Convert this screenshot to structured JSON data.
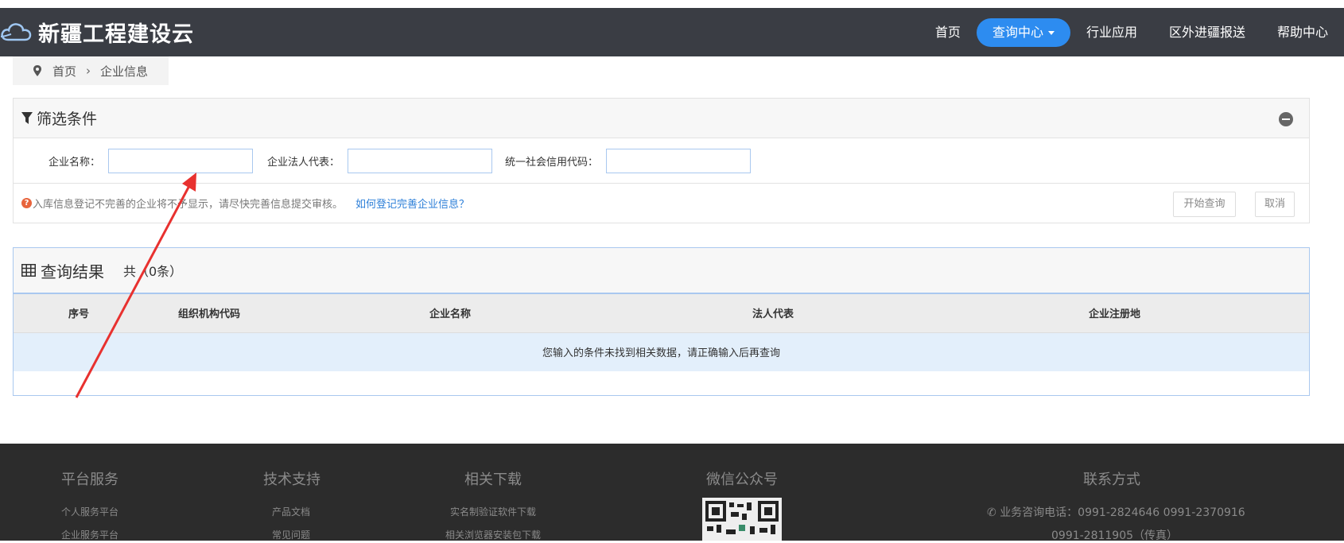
{
  "app": {
    "logo_text": "新疆工程建设云"
  },
  "nav": {
    "items": [
      {
        "label": "首页"
      },
      {
        "label": "查询中心",
        "active": true
      },
      {
        "label": "行业应用"
      },
      {
        "label": "区外进疆报送"
      },
      {
        "label": "帮助中心"
      }
    ]
  },
  "breadcrumb": {
    "home": "首页",
    "sep": "›",
    "current": "企业信息"
  },
  "filter": {
    "title": "筛选条件",
    "fields": [
      {
        "label": "企业名称：",
        "value": ""
      },
      {
        "label": "企业法人代表：",
        "value": ""
      },
      {
        "label": "统一社会信用代码：",
        "value": ""
      }
    ],
    "notice": "入库信息登记不完善的企业将不予显示，请尽快完善信息提交审核。",
    "help_link": "如何登记完善企业信息？",
    "search_button": "开始查询",
    "cancel_button": "取消"
  },
  "results": {
    "title": "查询结果",
    "count_text": "共（0条）",
    "columns": [
      "序号",
      "组织机构代码",
      "企业名称",
      "法人代表",
      "企业注册地"
    ],
    "empty_message": "您输入的条件未找到相关数据，请正确输入后再查询"
  },
  "footer": {
    "columns": [
      {
        "title": "平台服务",
        "links": [
          "个人服务平台",
          "企业服务平台"
        ]
      },
      {
        "title": "技术支持",
        "links": [
          "产品文档",
          "常见问题"
        ]
      },
      {
        "title": "相关下载",
        "links": [
          "实名制验证软件下载",
          "相关浏览器安装包下载"
        ]
      },
      {
        "title": "微信公众号",
        "links": []
      },
      {
        "title": "联系方式",
        "links": []
      }
    ],
    "contact_phone": "业务咨询电话：0991-2824646  0991-2370916",
    "contact_fax": "0991-2811905（传真）"
  },
  "colors": {
    "navbar": "#3a3d44",
    "accent": "#2d8cf0",
    "footer": "#2c2c2c",
    "annotation_arrow": "#e8312f"
  }
}
